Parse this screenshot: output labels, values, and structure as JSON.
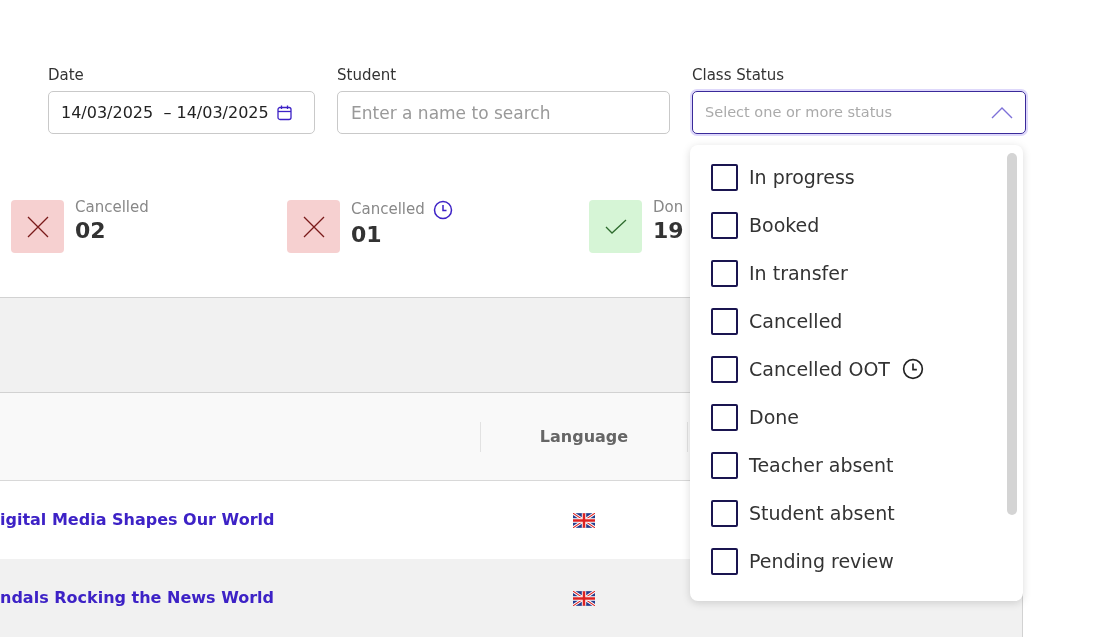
{
  "filters": {
    "date": {
      "label": "Date",
      "value": "14/03/2025  – 14/03/2025"
    },
    "student": {
      "label": "Student",
      "placeholder": "Enter a name to search"
    },
    "class_status": {
      "label": "Class Status",
      "placeholder": "Select one or more status",
      "expanded": true,
      "options": [
        {
          "label": "In progress",
          "checked": false,
          "kind": "plain"
        },
        {
          "label": "Booked",
          "checked": false,
          "kind": "plain"
        },
        {
          "label": "In transfer",
          "checked": false,
          "kind": "plain"
        },
        {
          "label": "Cancelled",
          "checked": false,
          "kind": "plain"
        },
        {
          "label": "Cancelled OOT",
          "checked": false,
          "kind": "clock"
        },
        {
          "label": "Done",
          "checked": false,
          "kind": "plain"
        },
        {
          "label": "Teacher absent",
          "checked": false,
          "kind": "plain"
        },
        {
          "label": "Student absent",
          "checked": false,
          "kind": "plain"
        },
        {
          "label": "Pending review",
          "checked": false,
          "kind": "plain"
        }
      ]
    }
  },
  "stats": [
    {
      "label": "Cancelled",
      "value": "02",
      "kind": "cancelled"
    },
    {
      "label": "Cancelled",
      "value": "01",
      "kind": "cancelled_late"
    },
    {
      "label": "Don",
      "value": "19",
      "kind": "done"
    }
  ],
  "table": {
    "columns": [
      "Language"
    ],
    "rows": [
      {
        "title": "igital Media Shapes Our World"
      },
      {
        "title": "ndals Rocking the News World"
      }
    ]
  }
}
